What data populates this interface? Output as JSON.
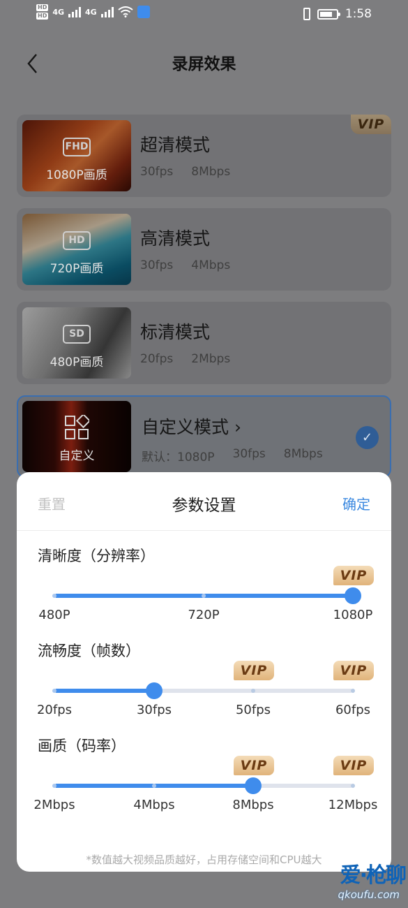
{
  "status_bar": {
    "hd_badge": "HD",
    "network": "4G",
    "network2": "4G",
    "time": "1:58"
  },
  "header": {
    "title": "录屏效果"
  },
  "modes": [
    {
      "name": "超清模式",
      "badge": "FHD",
      "quality": "1080P画质",
      "fps": "30fps",
      "bitrate": "8Mbps",
      "vip": "VIP"
    },
    {
      "name": "高清模式",
      "badge": "HD",
      "quality": "720P画质",
      "fps": "30fps",
      "bitrate": "4Mbps"
    },
    {
      "name": "标清模式",
      "badge": "SD",
      "quality": "480P画质",
      "fps": "20fps",
      "bitrate": "2Mbps"
    },
    {
      "name": "自定义模式",
      "chevron": "›",
      "quality": "自定义",
      "default_label": "默认：1080P",
      "fps": "30fps",
      "bitrate": "8Mbps",
      "selected": true
    }
  ],
  "sheet": {
    "reset": "重置",
    "title": "参数设置",
    "confirm": "确定",
    "resolution": {
      "label": "清晰度（分辨率）",
      "ticks": [
        "480P",
        "720P",
        "1080P"
      ],
      "selected_index": 2,
      "vip": "VIP"
    },
    "framerate": {
      "label": "流畅度（帧数）",
      "ticks": [
        "20fps",
        "30fps",
        "50fps",
        "60fps"
      ],
      "selected_index": 1,
      "vip": "VIP"
    },
    "bitrate": {
      "label": "画质（码率）",
      "ticks": [
        "2Mbps",
        "4Mbps",
        "8Mbps",
        "12Mbps"
      ],
      "selected_index": 2,
      "vip": "VIP"
    },
    "note": "*数值越大视频品质越好，占用存储空间和CPU越大"
  },
  "watermark": {
    "brand": "爱·枪聊",
    "domain": "qkoufu.com"
  },
  "colors": {
    "accent": "#3f8cec",
    "confirm": "#3d8ae0",
    "vip_gold": "#e0b37a",
    "overlay": "#7d7d7f"
  }
}
